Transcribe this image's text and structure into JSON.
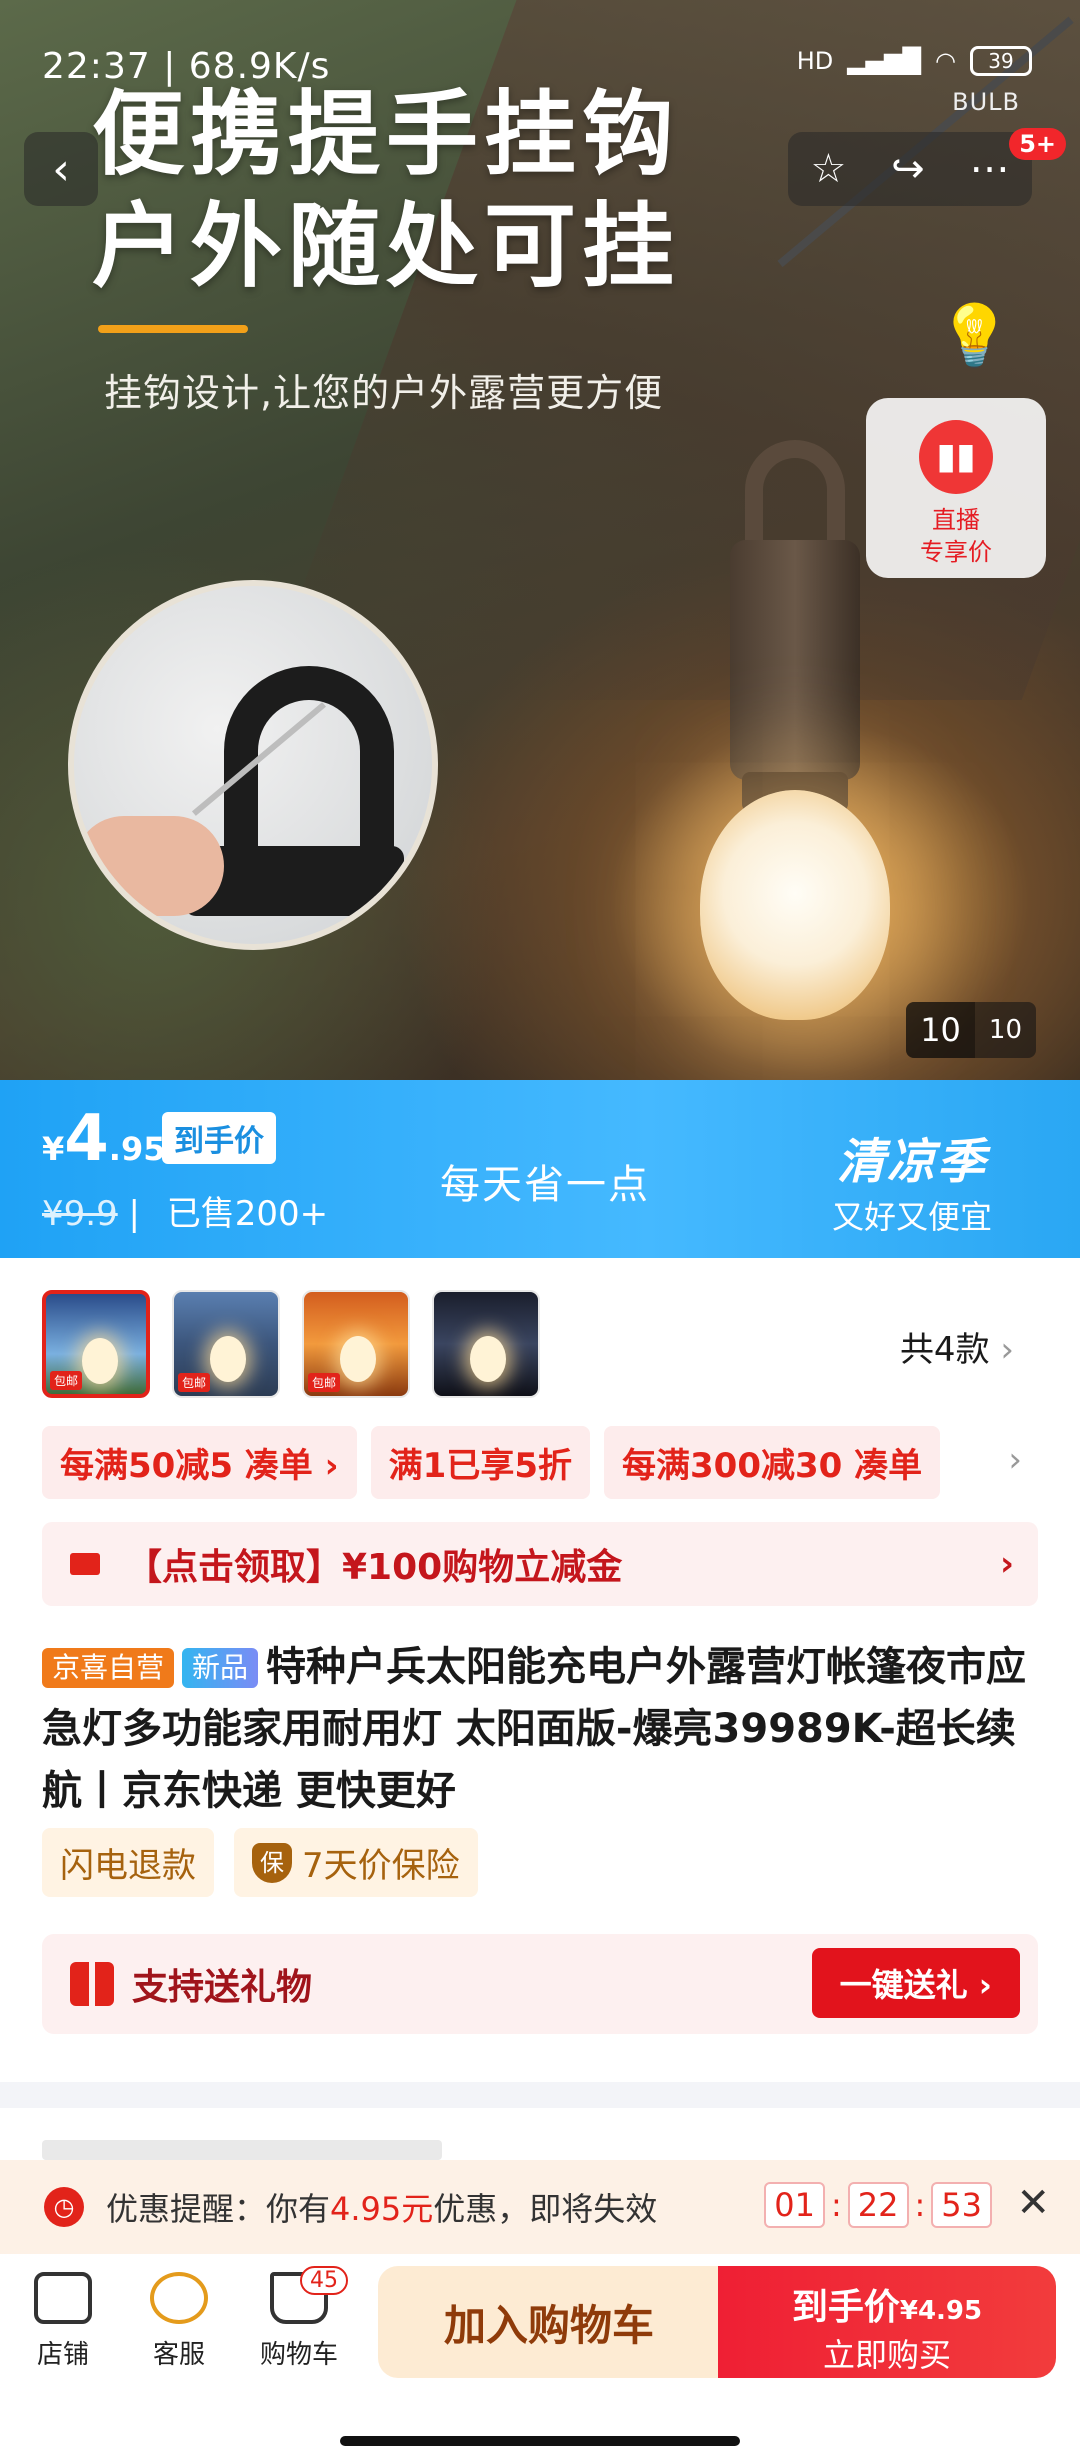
{
  "status_bar": {
    "time": "22:37",
    "net_speed": "68.9K/s",
    "network": "HD",
    "battery": "39",
    "carrier_label": "BULB"
  },
  "hero": {
    "title_line1": "便携提手挂钩",
    "title_line2": "户外随处可挂",
    "subtitle": "挂钩设计,让您的户外露营更方便",
    "notif_badge": "5+",
    "live_label_line1": "直播",
    "live_label_line2": "专享价",
    "image_counter_current": "10",
    "image_counter_total": "10"
  },
  "price_bar": {
    "currency": "¥",
    "price_int": "4",
    "price_dec": ".95",
    "price_tag": "到手价",
    "old_price": "¥9.9",
    "sold": "已售200+",
    "slogan": "每天省一点",
    "season_title": "清凉季",
    "season_sub": "又好又便宜"
  },
  "variants": {
    "count_label": "共4款",
    "thumb_tag": "包邮"
  },
  "coupons": [
    "每满50减5 凑单 ›",
    "满1已享5折",
    "每满300减30 凑单"
  ],
  "claim": {
    "text": "【点击领取】¥100购物立减金"
  },
  "product": {
    "badge_store": "京喜自营",
    "badge_new": "新品",
    "title": "特种户兵太阳能充电户外露营灯帐篷夜市应急灯多功能家用耐用灯 太阳面版-爆亮39989K-超长续航丨京东快递 更快更好"
  },
  "services": {
    "refund": "闪电退款",
    "insurance_icon": "保",
    "insurance": "7天价保险"
  },
  "gift": {
    "text": "支持送礼物",
    "button": "一键送礼 ›"
  },
  "reminder": {
    "prefix": "优惠提醒：你有",
    "amount": "4.95元",
    "suffix": "优惠，即将失效",
    "hh": "01",
    "mm": "22",
    "ss": "53"
  },
  "bottom": {
    "store": "店铺",
    "service": "客服",
    "cart": "购物车",
    "cart_count": "45",
    "add_cart": "加入购物车",
    "buy_price_label": "到手价",
    "buy_price": "¥4.95",
    "buy_now": "立即购买"
  }
}
